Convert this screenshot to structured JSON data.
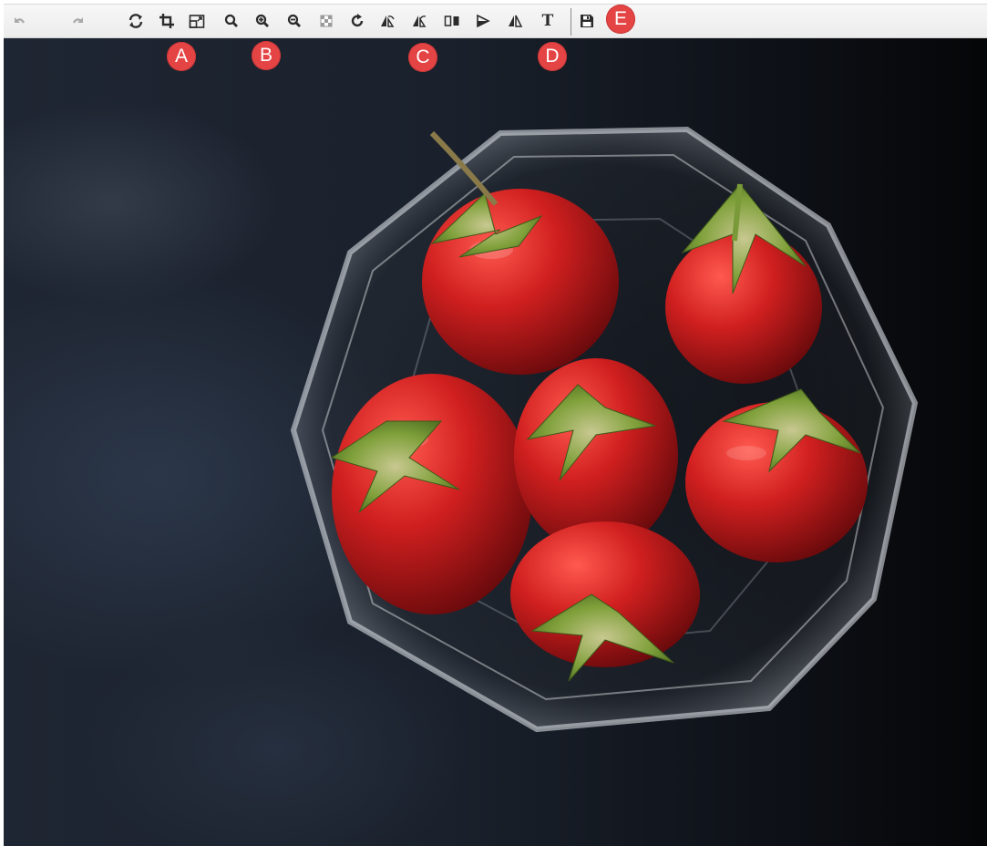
{
  "toolbar": {
    "buttons": [
      {
        "id": "undo",
        "icon": "undo-icon",
        "enabled": false
      },
      {
        "id": "redo",
        "icon": "redo-icon",
        "enabled": false
      },
      {
        "id": "reset",
        "icon": "reset-icon"
      },
      {
        "id": "crop",
        "icon": "crop-icon"
      },
      {
        "id": "resize",
        "icon": "resize-icon"
      },
      {
        "id": "zoom",
        "icon": "magnifier-icon"
      },
      {
        "id": "zoom-in",
        "icon": "zoom-in-icon"
      },
      {
        "id": "zoom-out",
        "icon": "zoom-out-icon"
      },
      {
        "id": "transparency",
        "icon": "checkerboard-icon"
      },
      {
        "id": "rotate",
        "icon": "rotate-icon"
      },
      {
        "id": "flip-a",
        "icon": "flip-icon"
      },
      {
        "id": "flip-b",
        "icon": "flip-icon"
      },
      {
        "id": "mirror",
        "icon": "mirror-icon"
      },
      {
        "id": "play",
        "icon": "play-icon"
      },
      {
        "id": "flip-horizontal",
        "icon": "flip-horizontal-icon"
      },
      {
        "id": "text",
        "icon": "text-icon",
        "label": "T"
      },
      {
        "id": "save",
        "icon": "save-icon"
      }
    ]
  },
  "markers": [
    "A",
    "B",
    "C",
    "D",
    "E"
  ],
  "colors": {
    "marker": "#e54444",
    "toolbar_bg": "#efefef",
    "icon": "#2b2b2b",
    "icon_disabled": "#a9a9a9"
  },
  "canvas": {
    "image_subject": "strawberries-in-glass-bowl"
  }
}
